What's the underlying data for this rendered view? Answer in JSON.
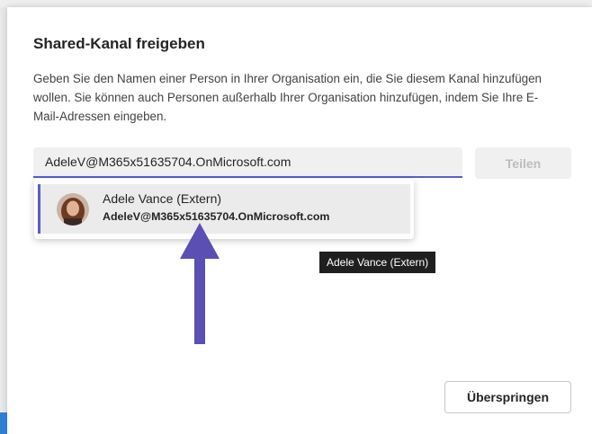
{
  "dialog": {
    "title": "Shared-Kanal freigeben",
    "description": "Geben Sie den Namen einer Person in Ihrer Organisation ein, die Sie diesem Kanal hinzufügen wollen. Sie können auch Personen außerhalb Ihrer Organisation hinzufügen, indem Sie Ihre E-Mail-Adressen eingeben."
  },
  "search": {
    "value": "AdeleV@M365x51635704.OnMicrosoft.com"
  },
  "buttons": {
    "share_label": "Teilen",
    "skip_label": "Überspringen"
  },
  "suggestion": {
    "name": "Adele Vance (Extern)",
    "email": "AdeleV@M365x51635704.OnMicrosoft.com"
  },
  "tooltip": {
    "text": "Adele Vance (Extern)"
  },
  "colors": {
    "accent": "#5b5fc7",
    "annotation_arrow": "#5b4fb4"
  }
}
